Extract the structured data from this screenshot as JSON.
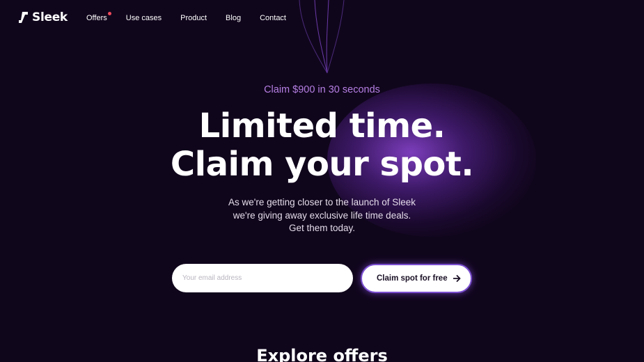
{
  "brand": {
    "name": "Sleek"
  },
  "nav": {
    "items": [
      {
        "label": "Offers",
        "has_notification": true
      },
      {
        "label": "Use cases"
      },
      {
        "label": "Product"
      },
      {
        "label": "Blog"
      },
      {
        "label": "Contact"
      }
    ]
  },
  "hero": {
    "eyebrow": "Claim $900 in 30 seconds",
    "headline_line1": "Limited time.",
    "headline_line2": "Claim your spot.",
    "subtext_line1": "As we're getting closer to the launch of Sleek",
    "subtext_line2": "we're giving away exclusive life time deals.",
    "subtext_line3": "Get them today."
  },
  "signup": {
    "email_placeholder": "Your email address",
    "email_value": "",
    "button_label": "Claim spot for free",
    "button_icon": "arrow-right-icon"
  },
  "explore": {
    "title": "Explore offers"
  },
  "colors": {
    "background": "#10061c",
    "accent": "#b57fe3",
    "glow": "#a050f0",
    "notification_dot": "#ef4a5a"
  }
}
